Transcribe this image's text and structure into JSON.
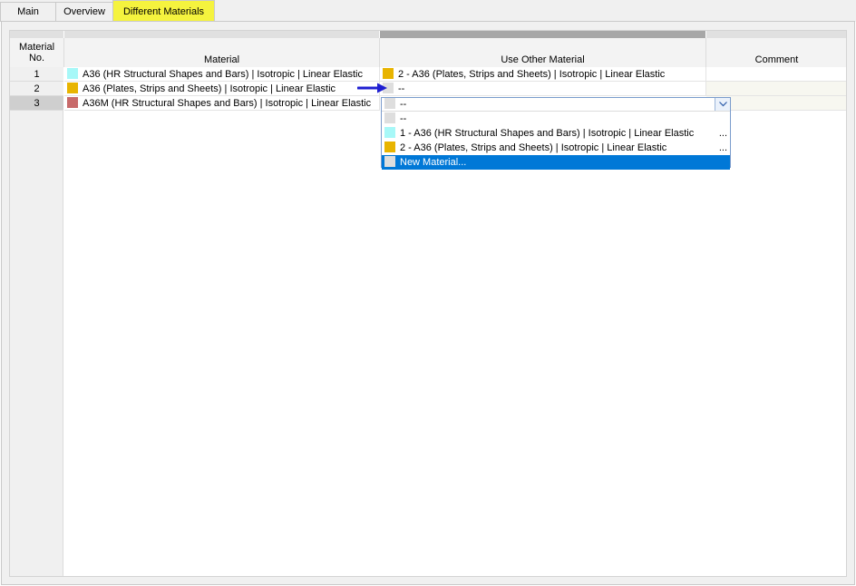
{
  "tabs": [
    {
      "label": "Main"
    },
    {
      "label": "Overview"
    },
    {
      "label": "Different Materials"
    }
  ],
  "colors": {
    "active_tab": "#f5f33e",
    "selection": "#0078d7",
    "arrow": "#1f1fd1",
    "cyan": "#a7f8f8",
    "gold": "#e8b400",
    "rose": "#c86a6a",
    "empty": "#dedede"
  },
  "table": {
    "headers": {
      "no": "Material\nNo.",
      "material": "Material",
      "use_other": "Use Other Material",
      "comment": "Comment"
    },
    "rows": [
      {
        "no": "1",
        "material": "A36 (HR Structural Shapes and Bars) | Isotropic | Linear Elastic",
        "material_color": "#a7f8f8",
        "use_other": "2 - A36 (Plates, Strips and Sheets) | Isotropic | Linear Elastic",
        "use_other_color": "#e8b400",
        "comment": ""
      },
      {
        "no": "2",
        "material": "A36 (Plates, Strips and Sheets) | Isotropic | Linear Elastic",
        "material_color": "#e8b400",
        "use_other": "--",
        "use_other_color": "#dedede",
        "comment": ""
      },
      {
        "no": "3",
        "material": "A36M (HR Structural Shapes and Bars) | Isotropic | Linear Elastic",
        "material_color": "#c86a6a",
        "use_other": "--",
        "use_other_color": "#dedede",
        "comment": ""
      }
    ]
  },
  "dropdown": {
    "value": "--",
    "options": [
      {
        "label": "--",
        "color": "#dedede",
        "dots": ""
      },
      {
        "label": "1 - A36 (HR Structural Shapes and Bars) | Isotropic | Linear Elastic",
        "color": "#a7f8f8",
        "dots": "..."
      },
      {
        "label": "2 - A36 (Plates, Strips and Sheets) | Isotropic | Linear Elastic",
        "color": "#e8b400",
        "dots": "..."
      },
      {
        "label": "New Material...",
        "color": "#dedede",
        "dots": ""
      }
    ],
    "selected_index": 3,
    "chevron_icon": "chevron-down-icon"
  },
  "arrow_icon": "arrow-right-icon"
}
